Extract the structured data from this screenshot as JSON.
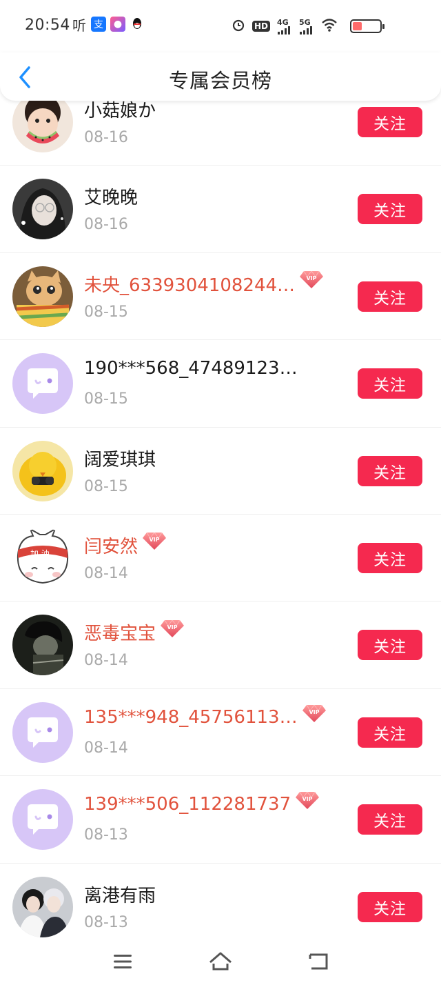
{
  "status_bar": {
    "time": "20:54",
    "left_icons": [
      "ting-icon",
      "alipay-icon",
      "app-icon",
      "qq-icon"
    ],
    "right_icons": [
      "alarm-icon",
      "hd-icon",
      "4g-signal-icon",
      "5g-signal-icon",
      "wifi-icon",
      "battery-icon"
    ],
    "hd_label": "HD",
    "net1_label": "4G",
    "net2_label": "5G",
    "battery_label": "4",
    "battery_fraction": 0.35
  },
  "header": {
    "title": "专属会员榜",
    "back_icon": "chevron-left-icon"
  },
  "colors": {
    "follow_button": "#f5294f",
    "vip_name": "#e1523c",
    "date": "#a9a9a9",
    "back_icon": "#1e90ff",
    "default_avatar": "#d7c6f7"
  },
  "follow_label": "关注",
  "members": [
    {
      "name": "小菇娘か",
      "date": "08-16",
      "vip": false,
      "avatar": "girl-watermelon"
    },
    {
      "name": "艾晚晚",
      "date": "08-16",
      "vip": false,
      "avatar": "girl-glasses"
    },
    {
      "name": "未央_6339304108244…",
      "date": "08-15",
      "vip": true,
      "avatar": "cat-photo"
    },
    {
      "name": "190***568_47489123…",
      "date": "08-15",
      "vip": false,
      "avatar": "default"
    },
    {
      "name": "阔爱琪琪",
      "date": "08-15",
      "vip": false,
      "avatar": "yellow-bird"
    },
    {
      "name": "闫安然",
      "date": "08-14",
      "vip": true,
      "avatar": "cartoon-cat"
    },
    {
      "name": "恶毒宝宝",
      "date": "08-14",
      "vip": true,
      "avatar": "dark-portrait"
    },
    {
      "name": "135***948_45756113…",
      "date": "08-14",
      "vip": true,
      "avatar": "default"
    },
    {
      "name": "139***506_112281737",
      "date": "08-13",
      "vip": true,
      "avatar": "default"
    },
    {
      "name": "离港有雨",
      "date": "08-13",
      "vip": false,
      "avatar": "two-people"
    }
  ],
  "navbar": {
    "icons": [
      "menu-icon",
      "home-icon",
      "back-icon"
    ]
  }
}
